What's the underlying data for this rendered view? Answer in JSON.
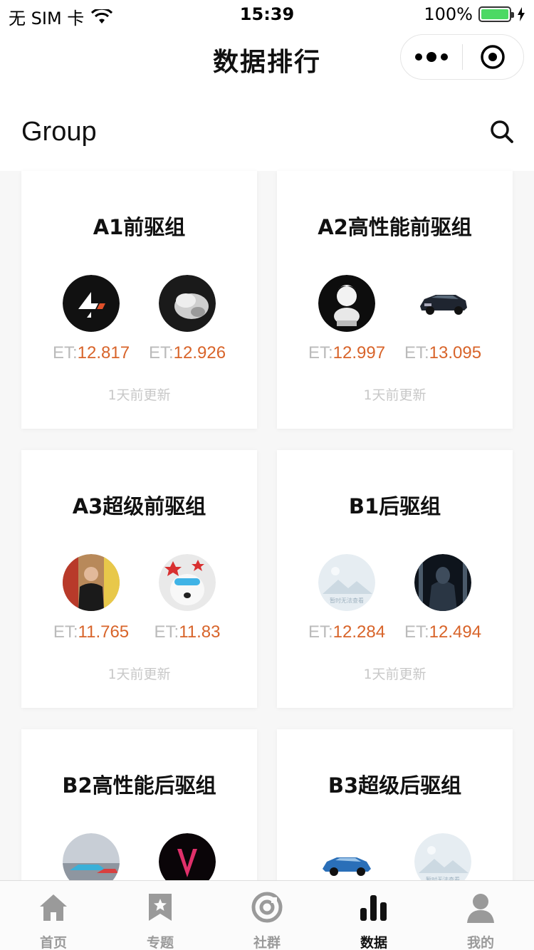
{
  "status": {
    "carrier": "无 SIM 卡",
    "time": "15:39",
    "battery": "100%"
  },
  "nav": {
    "title": "数据排行"
  },
  "section": {
    "title": "Group"
  },
  "et_prefix": "ET:",
  "cards": [
    {
      "name": "A1前驱组",
      "left_et": "12.817",
      "right_et": "12.926",
      "updated": "1天前更新"
    },
    {
      "name": "A2高性能前驱组",
      "left_et": "12.997",
      "right_et": "13.095",
      "updated": "1天前更新"
    },
    {
      "name": "A3超级前驱组",
      "left_et": "11.765",
      "right_et": "11.83",
      "updated": "1天前更新"
    },
    {
      "name": "B1后驱组",
      "left_et": "12.284",
      "right_et": "12.494",
      "updated": "1天前更新"
    },
    {
      "name": "B2高性能后驱组",
      "left_et": "",
      "right_et": "",
      "updated": ""
    },
    {
      "name": "B3超级后驱组",
      "left_et": "",
      "right_et": "",
      "updated": ""
    }
  ],
  "placeholder_text": "暂时无法查看",
  "tabs": [
    {
      "label": "首页",
      "icon": "home-icon"
    },
    {
      "label": "专题",
      "icon": "bookmark-icon"
    },
    {
      "label": "社群",
      "icon": "community-icon"
    },
    {
      "label": "数据",
      "icon": "bar-chart-icon",
      "active": true
    },
    {
      "label": "我的",
      "icon": "person-icon"
    }
  ],
  "colors": {
    "accent_value": "#d8642a",
    "muted": "#bbbbbb",
    "battery": "#4cd964"
  }
}
